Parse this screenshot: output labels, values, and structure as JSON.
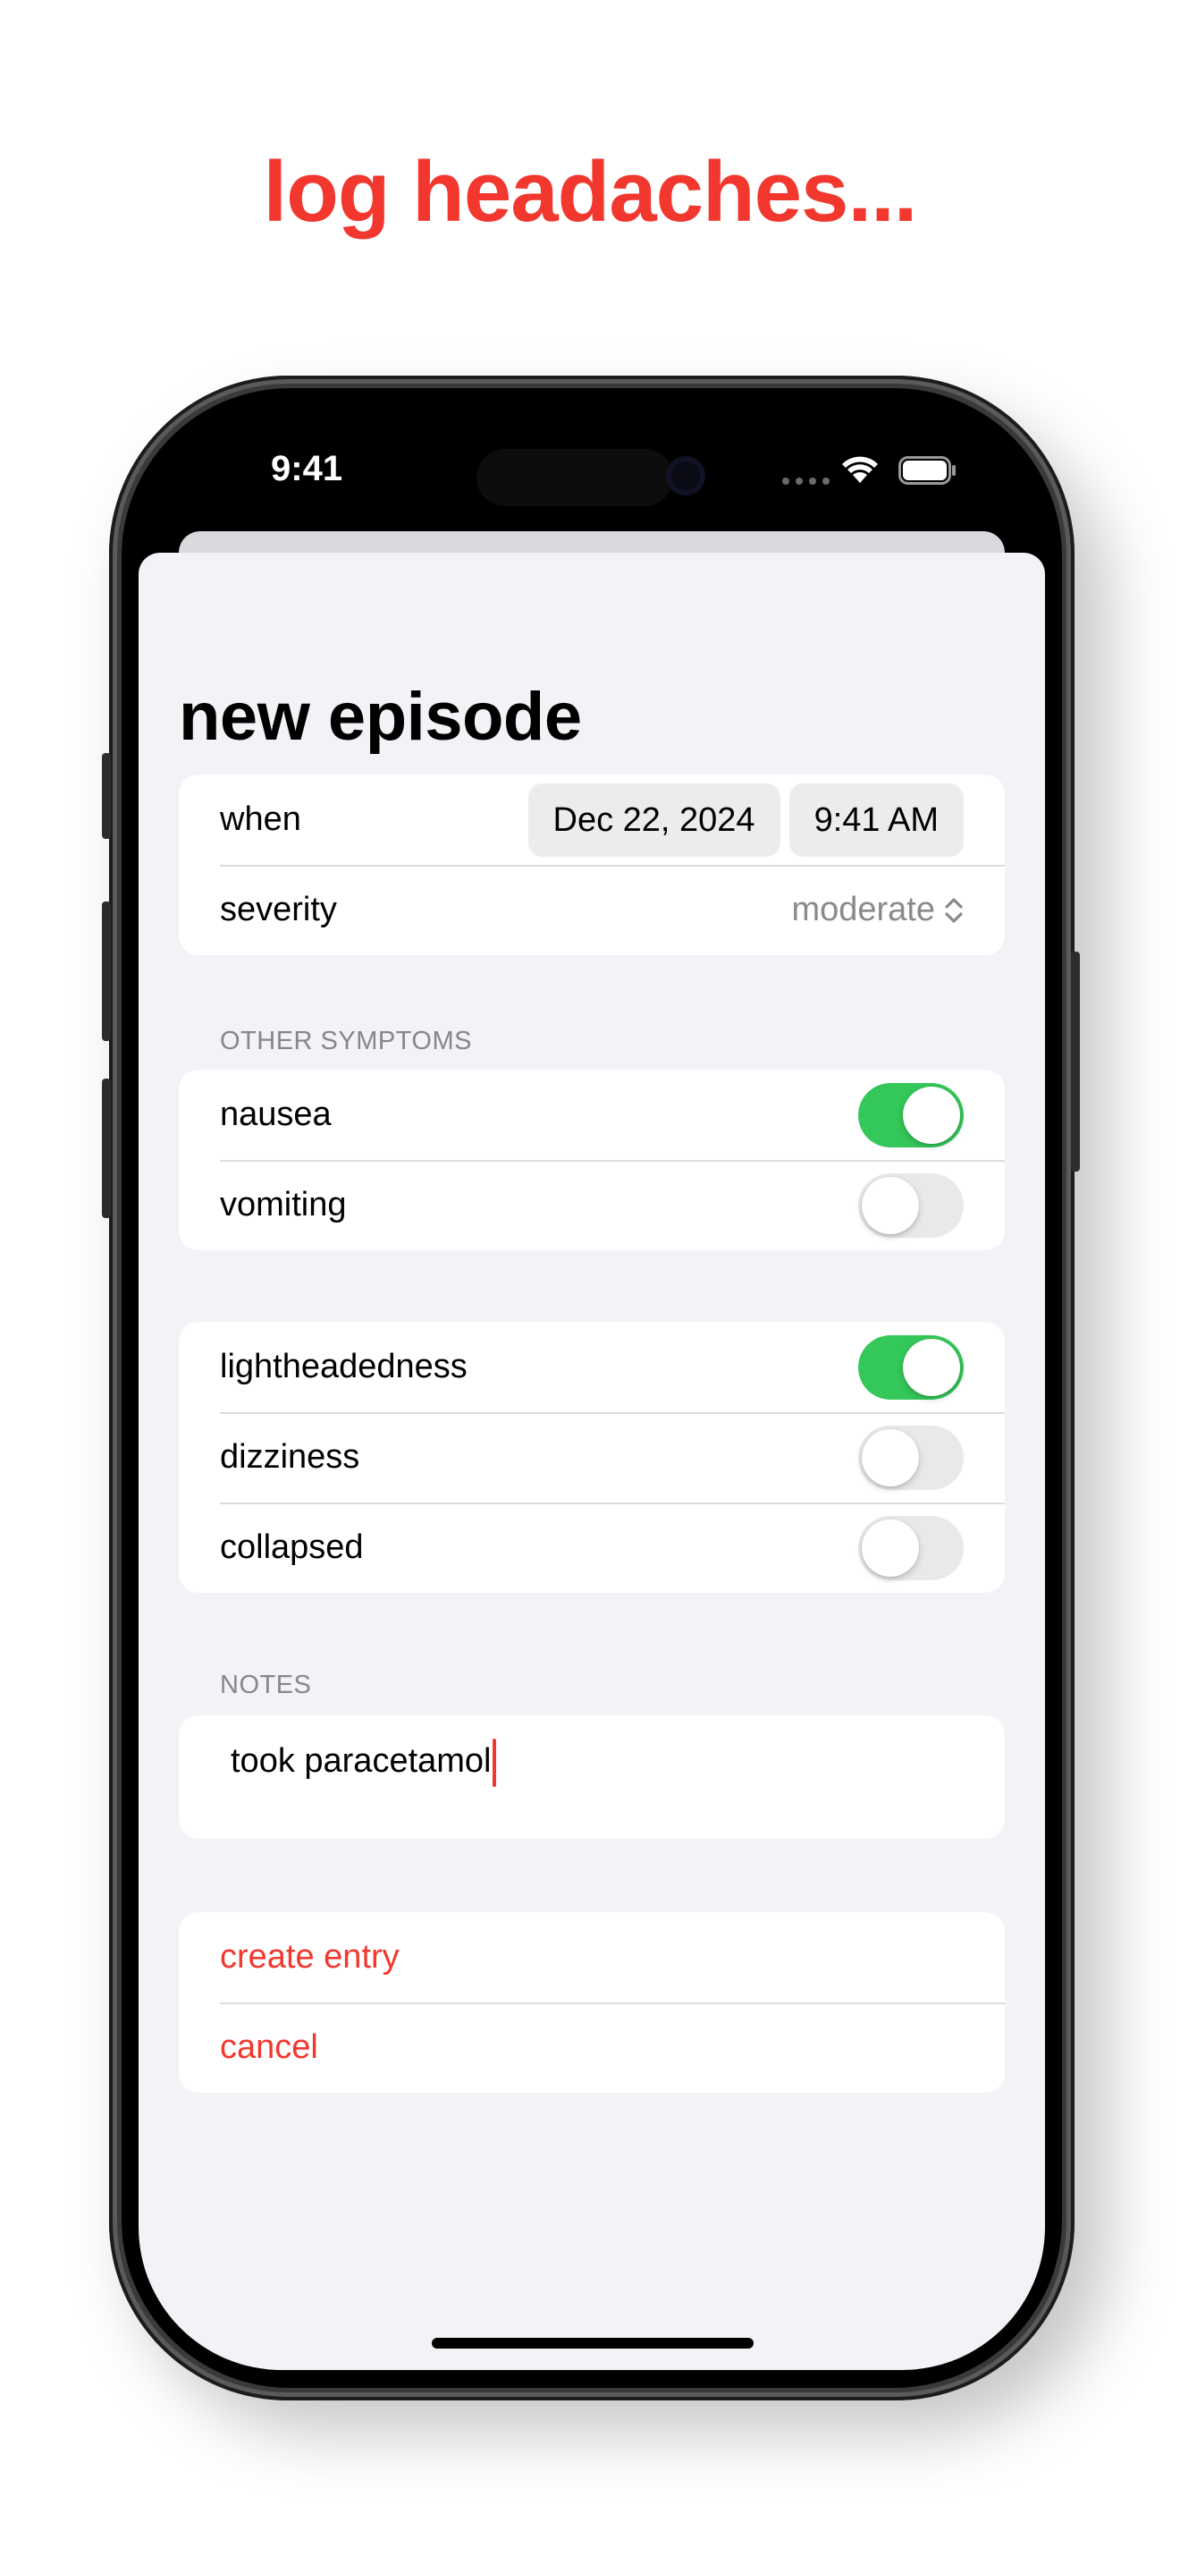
{
  "headline": "log headaches...",
  "status_bar": {
    "time": "9:41"
  },
  "form": {
    "title": "new episode",
    "when": {
      "label": "when",
      "date": "Dec 22, 2024",
      "time": "9:41 AM"
    },
    "severity": {
      "label": "severity",
      "value": "moderate"
    },
    "other_symptoms": {
      "header": "OTHER SYMPTOMS",
      "items": [
        {
          "label": "nausea",
          "on": true
        },
        {
          "label": "vomiting",
          "on": false
        }
      ]
    },
    "more_symptoms": {
      "items": [
        {
          "label": "lightheadedness",
          "on": true
        },
        {
          "label": "dizziness",
          "on": false
        },
        {
          "label": "collapsed",
          "on": false
        }
      ]
    },
    "notes": {
      "header": "NOTES",
      "value": "took paracetamol"
    },
    "actions": {
      "create": "create entry",
      "cancel": "cancel"
    }
  },
  "colors": {
    "accent": "#f2382e",
    "toggle_on": "#34c759",
    "toggle_off": "#e9e9eb",
    "background": "#f2f2f7"
  },
  "icons": [
    "wifi-icon",
    "battery-icon",
    "chevron-up-down-icon",
    "text-cursor"
  ]
}
